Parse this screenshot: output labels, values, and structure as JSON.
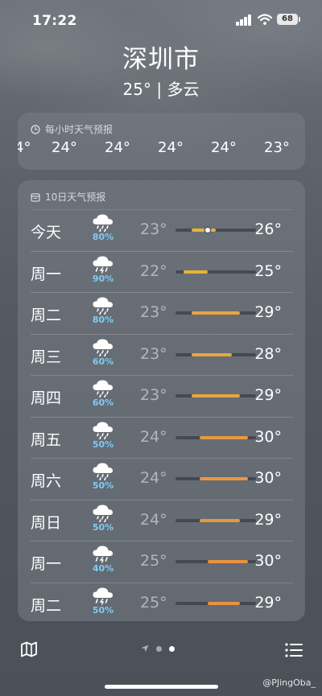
{
  "status_bar": {
    "time": "17:22",
    "battery": "68"
  },
  "header": {
    "city": "深圳市",
    "condition": "25° | 多云"
  },
  "hourly": {
    "title": "每小时天气预报",
    "temps": [
      "4°",
      "24°",
      "24°",
      "24°",
      "24°",
      "23°"
    ]
  },
  "daily": {
    "title": "10日天气预报",
    "range_min": 21,
    "range_max": 31,
    "current_temp": 25,
    "days": [
      {
        "day": "今天",
        "precip": "80%",
        "low": "23°",
        "high": "26°",
        "low_val": 23,
        "high_val": 26,
        "icon": "rain-cloud-icon",
        "color": "#e9b23a"
      },
      {
        "day": "周一",
        "precip": "90%",
        "low": "22°",
        "high": "25°",
        "low_val": 22,
        "high_val": 25,
        "icon": "thunderstorm-cloud-icon",
        "color": "#e9b23a"
      },
      {
        "day": "周二",
        "precip": "80%",
        "low": "23°",
        "high": "29°",
        "low_val": 23,
        "high_val": 29,
        "icon": "rain-cloud-icon",
        "color": "#e8a63c"
      },
      {
        "day": "周三",
        "precip": "60%",
        "low": "23°",
        "high": "28°",
        "low_val": 23,
        "high_val": 28,
        "icon": "rain-cloud-icon",
        "color": "#e8a63c"
      },
      {
        "day": "周四",
        "precip": "60%",
        "low": "23°",
        "high": "29°",
        "low_val": 23,
        "high_val": 29,
        "icon": "rain-cloud-icon",
        "color": "#e8a63c"
      },
      {
        "day": "周五",
        "precip": "50%",
        "low": "24°",
        "high": "30°",
        "low_val": 24,
        "high_val": 30,
        "icon": "rain-cloud-icon",
        "color": "#e8983e"
      },
      {
        "day": "周六",
        "precip": "50%",
        "low": "24°",
        "high": "30°",
        "low_val": 24,
        "high_val": 30,
        "icon": "rain-cloud-icon",
        "color": "#e8983e"
      },
      {
        "day": "周日",
        "precip": "50%",
        "low": "24°",
        "high": "29°",
        "low_val": 24,
        "high_val": 29,
        "icon": "rain-cloud-icon",
        "color": "#e8983e"
      },
      {
        "day": "周一",
        "precip": "40%",
        "low": "25°",
        "high": "30°",
        "low_val": 25,
        "high_val": 30,
        "icon": "thunderstorm-cloud-icon",
        "color": "#e8923f"
      },
      {
        "day": "周二",
        "precip": "50%",
        "low": "25°",
        "high": "29°",
        "low_val": 25,
        "high_val": 29,
        "icon": "thunderstorm-cloud-icon",
        "color": "#e8923f"
      }
    ]
  },
  "bottom_bar": {
    "watermark": "@PJingOba_"
  }
}
